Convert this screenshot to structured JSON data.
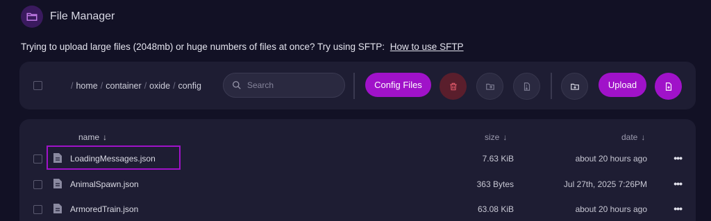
{
  "header": {
    "title": "File Manager",
    "icon": "folder-icon"
  },
  "notice": {
    "text": "Trying to upload large files (2048mb) or huge numbers of files at once? Try using SFTP:",
    "link": "How to use SFTP"
  },
  "toolbar": {
    "breadcrumb": [
      "home",
      "container",
      "oxide",
      "config"
    ],
    "search_placeholder": "Search",
    "config_files_label": "Config Files",
    "upload_label": "Upload",
    "accent": "#a012c9"
  },
  "table": {
    "columns": {
      "name": "name",
      "size": "size",
      "date": "date"
    },
    "rows": [
      {
        "name": "LoadingMessages.json",
        "size": "7.63 KiB",
        "date": "about 20 hours ago"
      },
      {
        "name": "AnimalSpawn.json",
        "size": "363 Bytes",
        "date": "Jul 27th, 2025 7:26PM"
      },
      {
        "name": "ArmoredTrain.json",
        "size": "63.08 KiB",
        "date": "about 20 hours ago"
      }
    ],
    "more_label": "•••"
  }
}
